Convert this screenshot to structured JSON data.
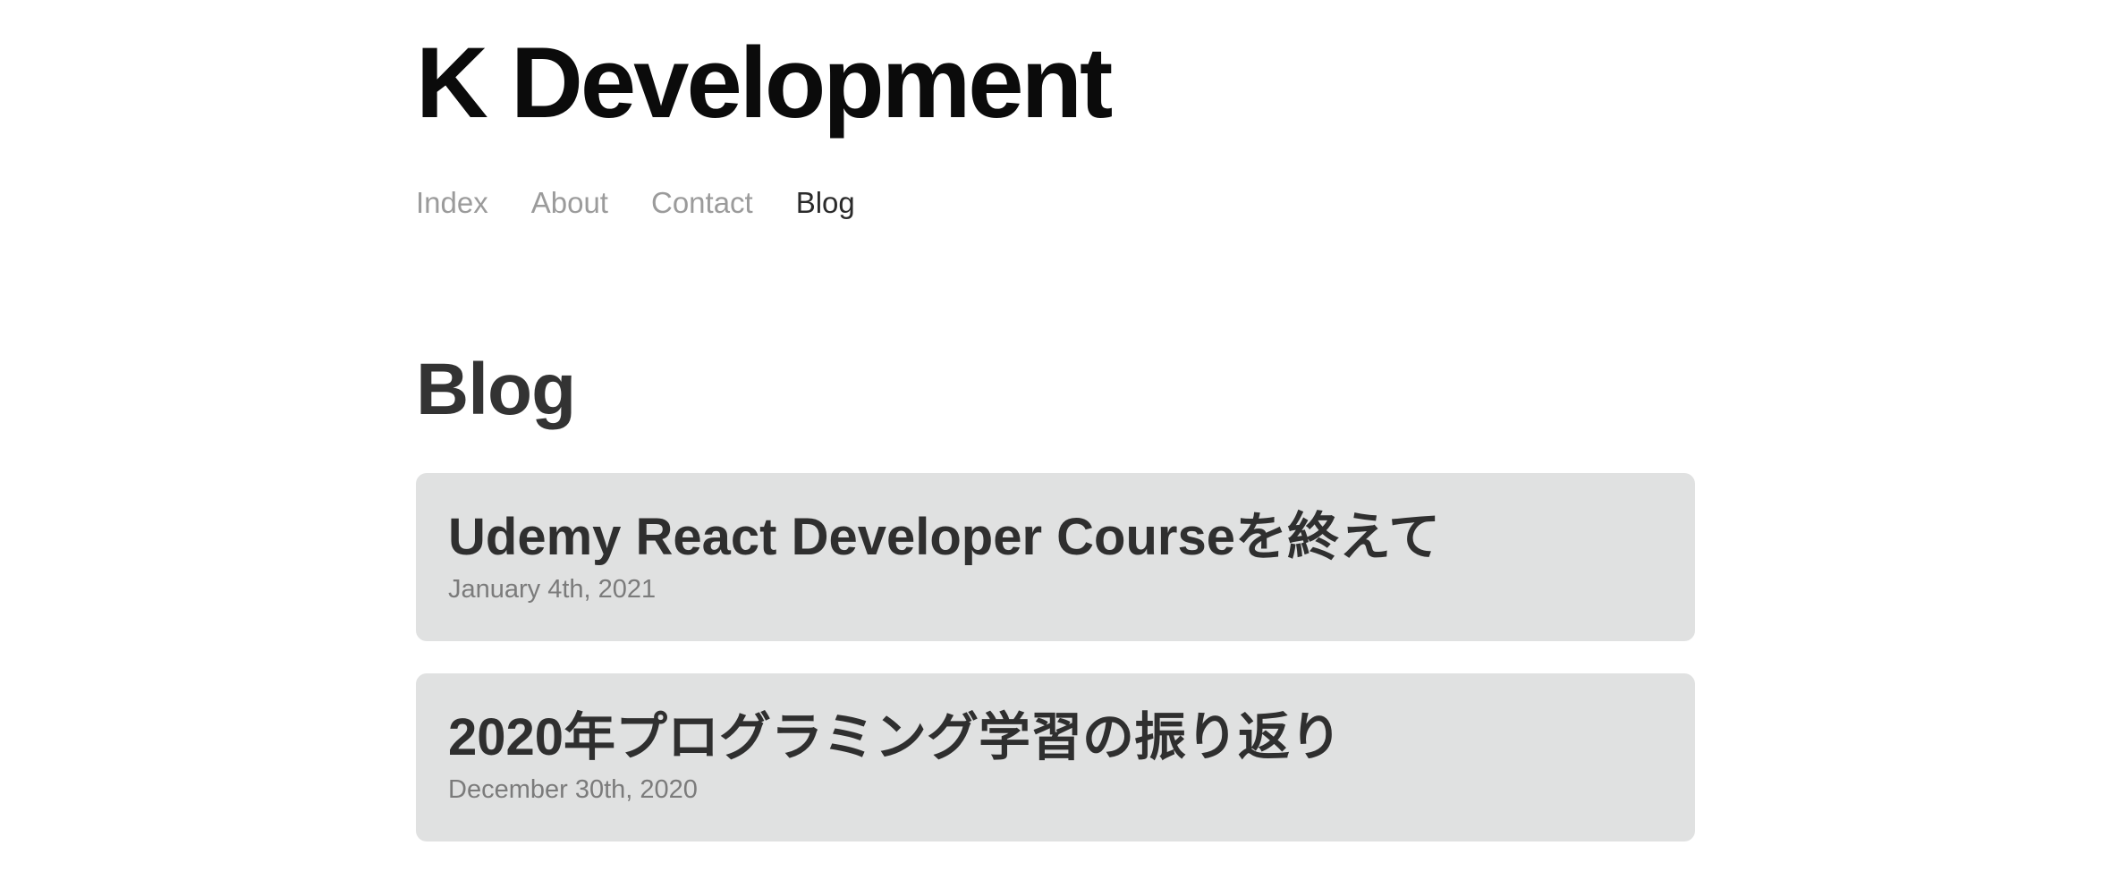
{
  "site": {
    "title": "K Development"
  },
  "nav": {
    "items": [
      {
        "label": "Index"
      },
      {
        "label": "About"
      },
      {
        "label": "Contact"
      },
      {
        "label": "Blog"
      }
    ]
  },
  "page": {
    "heading": "Blog"
  },
  "posts": [
    {
      "title": "Udemy React Developer Courseを終えて",
      "date": "January 4th, 2021"
    },
    {
      "title": "2020年プログラミング学習の振り返り",
      "date": "December 30th, 2020"
    }
  ]
}
